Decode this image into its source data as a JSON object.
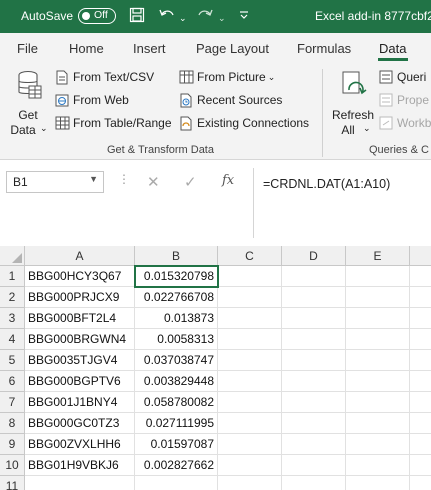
{
  "titlebar": {
    "autosave_label": "AutoSave",
    "toggle_state": "Off",
    "title": "Excel add-in 8777cbf2"
  },
  "tabs": [
    {
      "label": "File"
    },
    {
      "label": "Home"
    },
    {
      "label": "Insert"
    },
    {
      "label": "Page Layout"
    },
    {
      "label": "Formulas"
    },
    {
      "label": "Data"
    }
  ],
  "active_tab": "Data",
  "ribbon": {
    "get_data_line1": "Get",
    "get_data_line2": "Data",
    "from_text_csv": "From Text/CSV",
    "from_web": "From Web",
    "from_table_range": "From Table/Range",
    "from_picture": "From Picture",
    "recent_sources": "Recent Sources",
    "existing_connections": "Existing Connections",
    "group1_label": "Get & Transform Data",
    "refresh_line1": "Refresh",
    "refresh_line2": "All",
    "queries_label": "Queri",
    "properties_label": "Prope",
    "workbook_label": "Workb",
    "group2_label": "Queries & C"
  },
  "formula_bar": {
    "name_box": "B1",
    "formula": "=CRDNL.DAT(A1:A10)"
  },
  "grid": {
    "columns": [
      "A",
      "B",
      "C",
      "D",
      "E"
    ],
    "rows": [
      {
        "num": "1",
        "a": "BBG00HCY3Q67",
        "b": "0.015320798"
      },
      {
        "num": "2",
        "a": "BBG000PRJCX9",
        "b": "0.022766708"
      },
      {
        "num": "3",
        "a": "BBG000BFT2L4",
        "b": "0.013873"
      },
      {
        "num": "4",
        "a": "BBG000BRGWN4",
        "b": "0.0058313"
      },
      {
        "num": "5",
        "a": "BBG0035TJGV4",
        "b": "0.037038747"
      },
      {
        "num": "6",
        "a": "BBG000BGPTV6",
        "b": "0.003829448"
      },
      {
        "num": "7",
        "a": "BBG001J1BNY4",
        "b": "0.058780082"
      },
      {
        "num": "8",
        "a": "BBG000GC0TZ3",
        "b": "0.027111995"
      },
      {
        "num": "9",
        "a": "BBG00ZVXLHH6",
        "b": "0.01597087"
      },
      {
        "num": "10",
        "a": "BBG01H9VBKJ6",
        "b": "0.002827662"
      },
      {
        "num": "11",
        "a": "",
        "b": ""
      }
    ]
  },
  "colors": {
    "accent": "#217346",
    "ribbon_bg": "#f3f3f3"
  }
}
